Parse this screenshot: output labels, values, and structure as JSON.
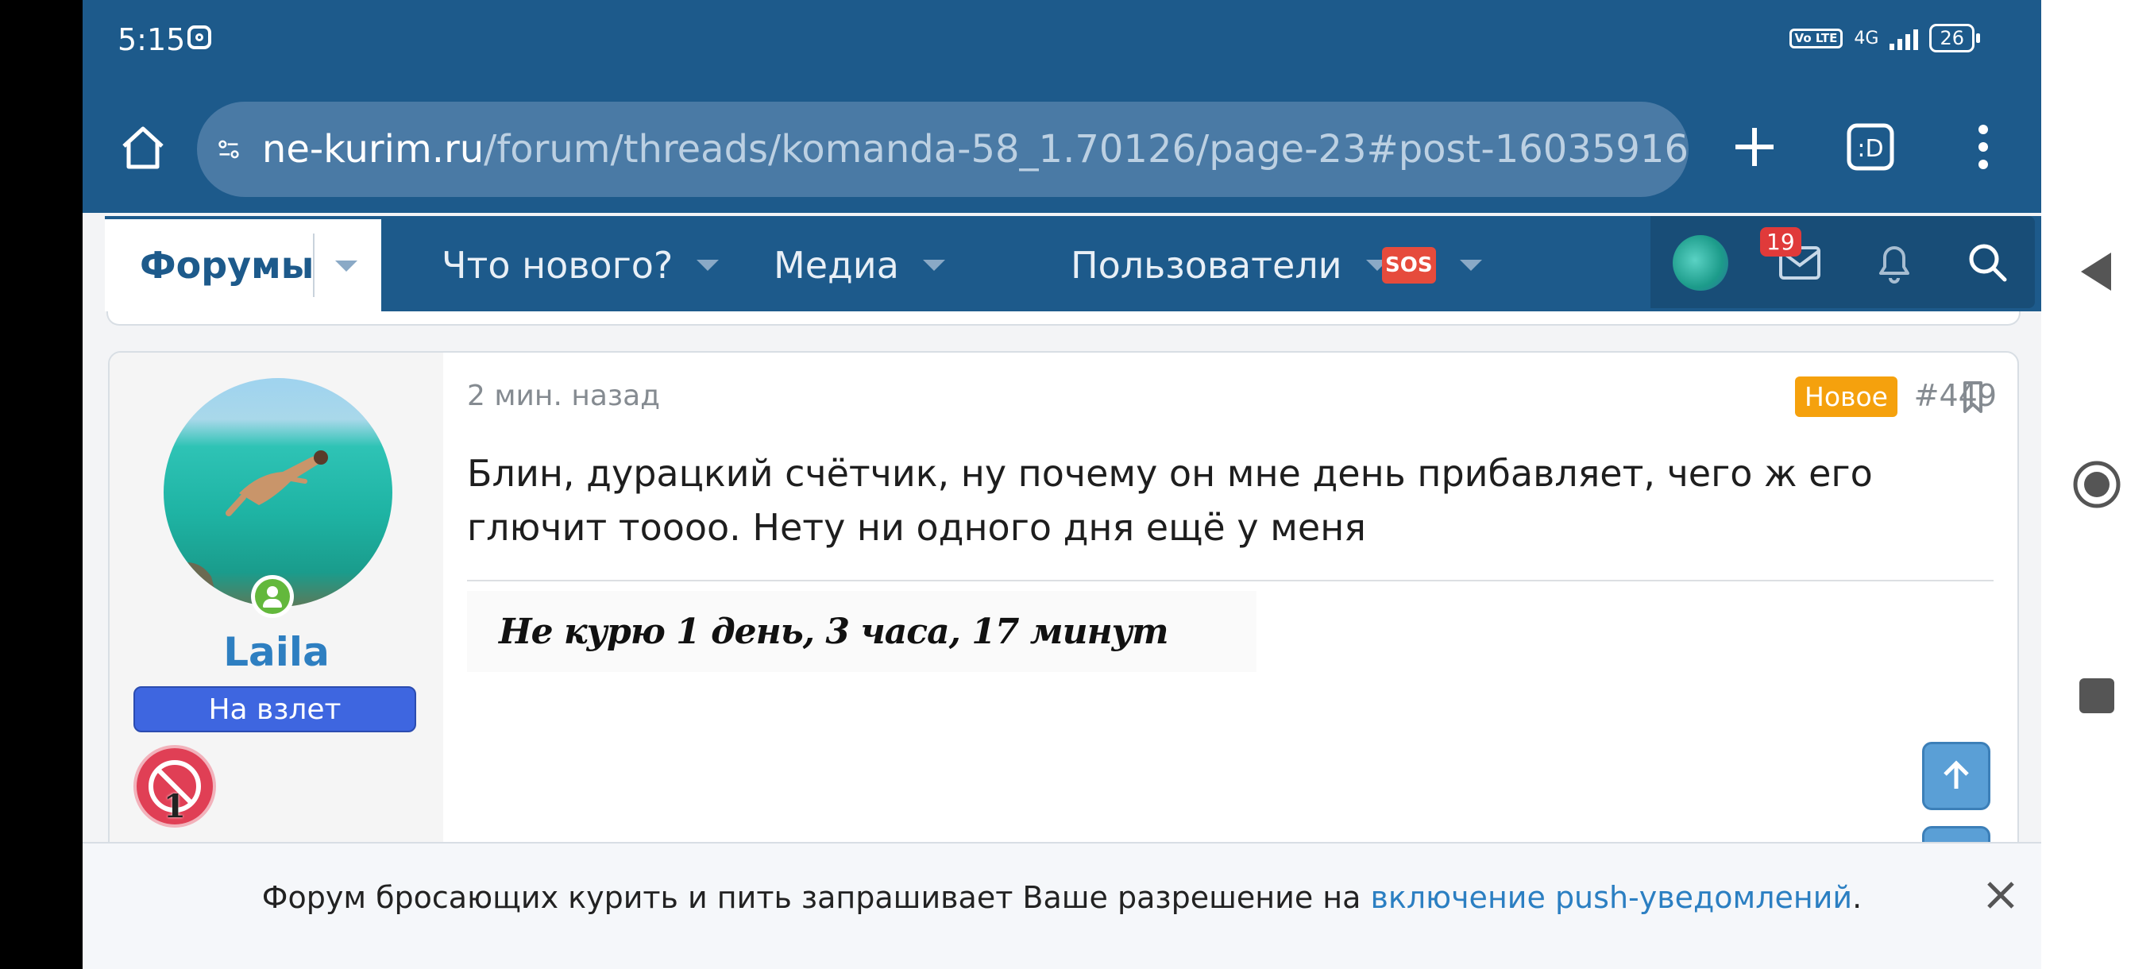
{
  "status": {
    "time": "5:15",
    "network": "4G",
    "volte": "Vo LTE",
    "battery": "26"
  },
  "browser": {
    "url_host": "ne-kurim.ru",
    "url_path": "/forum/threads/komanda-58_1.70126/page-23#post-16035916",
    "tab_icon_label": ":D"
  },
  "nav": {
    "forums": "Форумы",
    "whats_new": "Что нового?",
    "media": "Медиа",
    "users": "Пользователи",
    "sos": "🆘",
    "inbox_count": "19"
  },
  "post": {
    "time": "2 мин. назад",
    "new_badge": "Новое",
    "number": "#449",
    "body": "Блин, дурацкий счётчик, ну почему он мне день прибавляет, чего ж его глючит тоооо. Нету ни одного дня ещё у меня",
    "signature": "Не курю 1 день, 3 часа, 17 минут"
  },
  "user": {
    "name": "Laila",
    "title": "На взлет",
    "trophy_count": "1"
  },
  "push": {
    "text": "Форум бросающих курить и пить запрашивает Ваше разрешение на ",
    "link": "включение push-уведомлений",
    "end": "."
  },
  "colors": {
    "header": "#1d5a8b",
    "accent": "#2e7fc1",
    "new_badge": "#f5a10d",
    "user_title": "#3e66e0"
  }
}
